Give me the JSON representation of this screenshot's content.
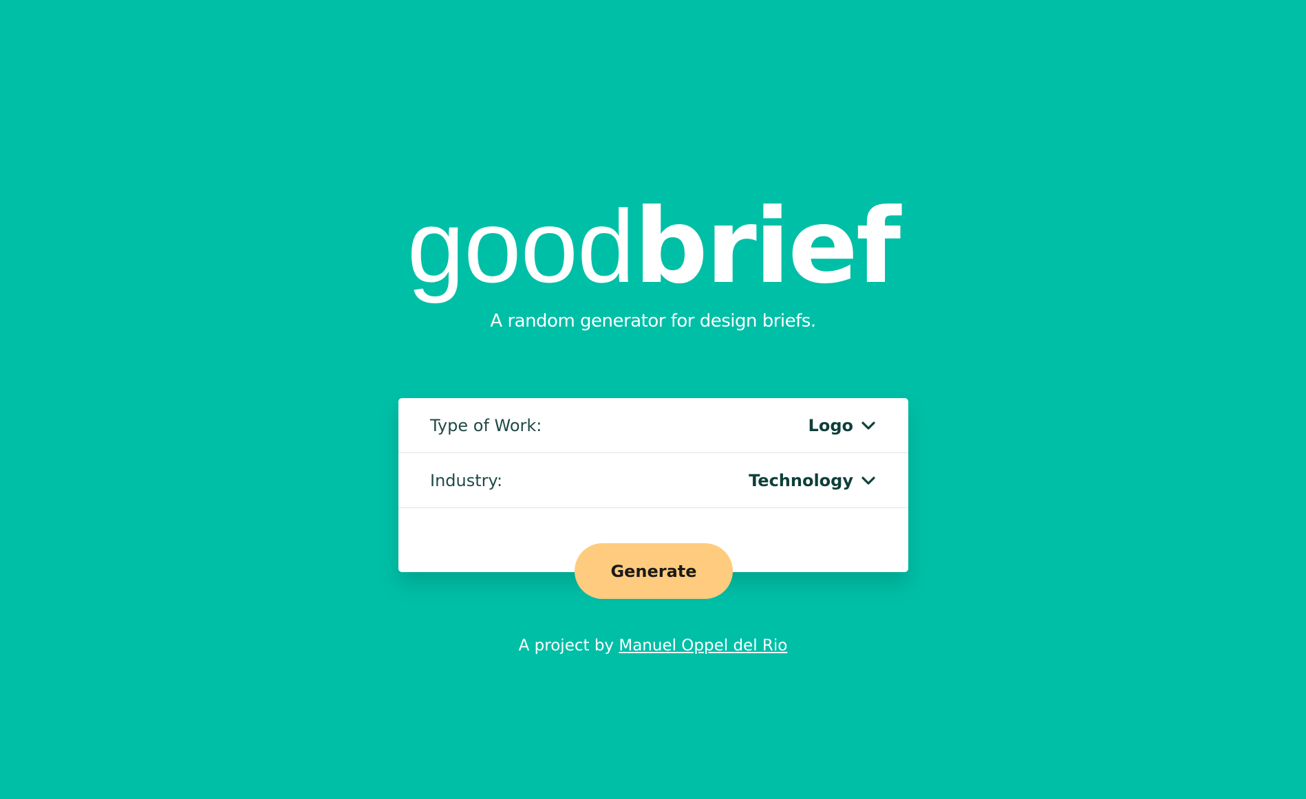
{
  "brand": {
    "light": "good",
    "bold": "brief"
  },
  "tagline": "A random generator for design briefs.",
  "form": {
    "rows": [
      {
        "label": "Type of Work:",
        "value": "Logo",
        "icon": "chevron-down-icon"
      },
      {
        "label": "Industry:",
        "value": "Technology",
        "icon": "chevron-down-icon"
      }
    ],
    "generate_label": "Generate"
  },
  "footer": {
    "prefix": "A project by",
    "author_link": "Manuel Oppel del Rio"
  },
  "colors": {
    "background": "#00BFA7",
    "card": "#FFFFFF",
    "button": "#FFCB7E",
    "text_dark": "#0F3F3A"
  }
}
